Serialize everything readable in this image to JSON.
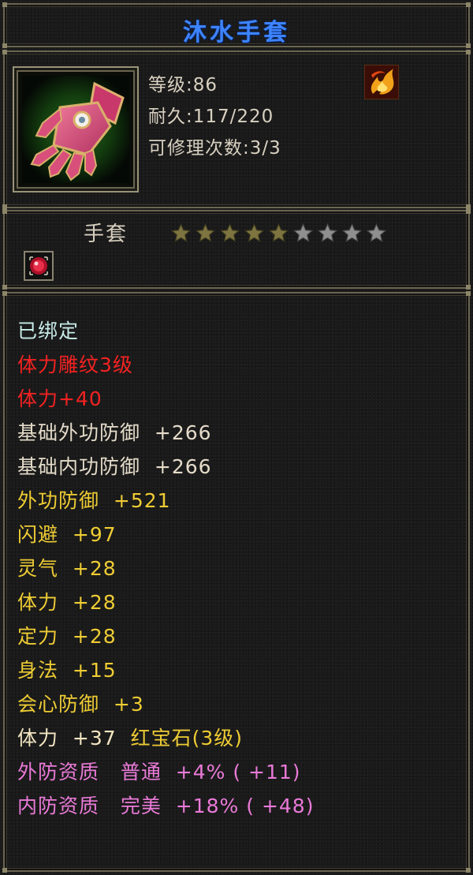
{
  "title": "沐水手套",
  "header": {
    "level": "等级:86",
    "durability": "耐久:117/220",
    "repairs": "可修理次数:3/3",
    "element_icon": "fire-element-icon"
  },
  "type": {
    "label": "手套",
    "stars_total": 9,
    "stars_filled": 5
  },
  "status": {
    "bound": "已绑定"
  },
  "engraving": {
    "name": "体力雕纹3级",
    "bonus": "体力+40"
  },
  "stats": [
    {
      "text": "基础外功防御  +266"
    },
    {
      "text": "基础内功防御  +266"
    },
    {
      "text": "外功防御  +521"
    },
    {
      "text": "闪避  +97"
    },
    {
      "text": "灵气  +28"
    },
    {
      "text": "体力  +28"
    },
    {
      "text": "定力  +28"
    },
    {
      "text": "身法  +15"
    },
    {
      "text": "会心防御  +3"
    }
  ],
  "gem": {
    "stat": "体力  +37",
    "name": "红宝石(3级)"
  },
  "qualities": [
    {
      "label": "外防资质",
      "grade": "普通",
      "value": "+4%",
      "bonus": "( +11)"
    },
    {
      "label": "内防资质",
      "grade": "完美",
      "value": "+18%",
      "bonus": "( +48)"
    }
  ],
  "colors": {
    "title": "#3d84ff",
    "bound": "#c8ece8",
    "engraving": "#f42222",
    "base_stat": "#e4dbc9",
    "stat": "#eecc34",
    "quality": "#ea7ad8"
  }
}
